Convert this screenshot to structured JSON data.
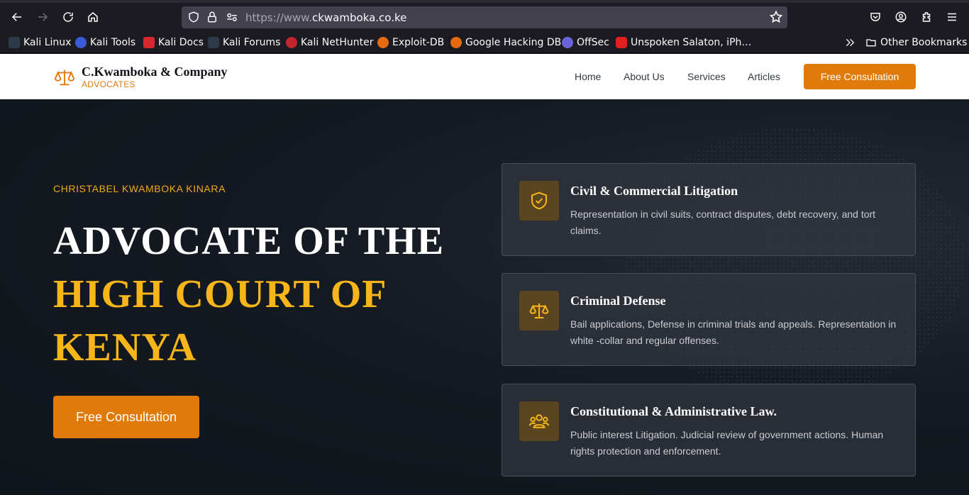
{
  "browser": {
    "url_prefix": "https://www.",
    "url_domain": "ckwamboka.co.ke",
    "bookmarks": [
      {
        "label": "Kali Linux",
        "icon": "kali-dragon-icon"
      },
      {
        "label": "Kali Tools",
        "icon": "kali-tools-icon"
      },
      {
        "label": "Kali Docs",
        "icon": "kali-docs-icon"
      },
      {
        "label": "Kali Forums",
        "icon": "kali-dragon-icon"
      },
      {
        "label": "Kali NetHunter",
        "icon": "nethunter-icon"
      },
      {
        "label": "Exploit-DB",
        "icon": "exploit-db-icon"
      },
      {
        "label": "Google Hacking DB",
        "icon": "ghdb-icon"
      },
      {
        "label": "OffSec",
        "icon": "offsec-icon"
      },
      {
        "label": "Unspoken Salaton, iPh…",
        "icon": "youtube-icon"
      }
    ],
    "other_bookmarks": "Other Bookmarks"
  },
  "header": {
    "brand_name": "C.Kwamboka & Company",
    "brand_tag": "ADVOCATES",
    "nav": [
      "Home",
      "About Us",
      "Services",
      "Articles"
    ],
    "cta": "Free Consultation"
  },
  "hero": {
    "eyebrow": "CHRISTABEL KWAMBOKA KINARA",
    "headline_line1": "ADVOCATE OF THE",
    "headline_line2": "HIGH COURT OF",
    "headline_line3": "KENYA",
    "cta": "Free Consultation"
  },
  "services": [
    {
      "icon": "shield-check-icon",
      "title": "Civil & Commercial Litigation",
      "desc": "Representation in civil suits, contract disputes, debt recovery, and tort claims."
    },
    {
      "icon": "scales-icon",
      "title": "Criminal Defense",
      "desc": "Bail applications, Defense in criminal trials and appeals. Representation in white -collar and regular offenses."
    },
    {
      "icon": "people-group-icon",
      "title": "Constitutional & Administrative Law.",
      "desc": "Public interest Litigation. Judicial review of government actions. Human rights protection and enforcement."
    }
  ],
  "colors": {
    "accent_orange": "#e07b0a",
    "accent_gold": "#f5b51b",
    "hero_bg": "#10141b"
  }
}
